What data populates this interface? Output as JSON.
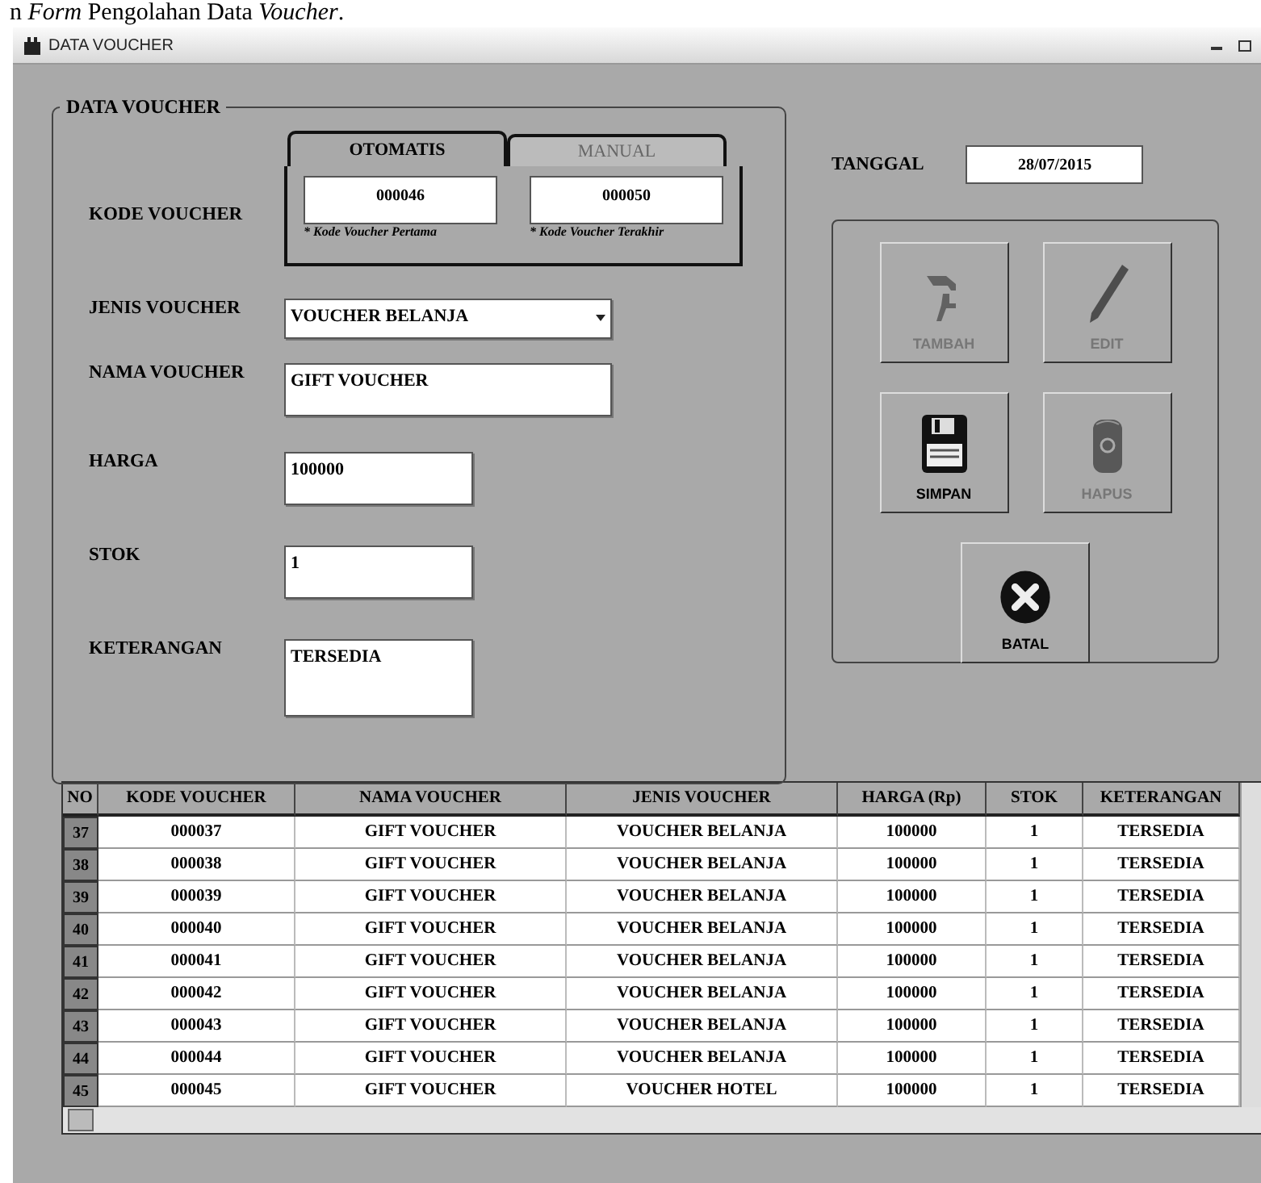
{
  "caption": "n *Form* Pengolahan Data *Voucher*.",
  "window": {
    "title": "DATA VOUCHER"
  },
  "group": {
    "title": "DATA VOUCHER",
    "kode_voucher": {
      "label": "KODE VOUCHER",
      "tabs": [
        {
          "label": "OTOMATIS",
          "selected": true
        },
        {
          "label": "MANUAL",
          "selected": false
        }
      ],
      "fields": [
        {
          "value": "000046",
          "hint": "* Kode Voucher Pertama"
        },
        {
          "value": "000050",
          "hint": "* Kode Voucher Terakhir"
        }
      ]
    },
    "fields": [
      {
        "kind": "dropdown",
        "label": "JENIS VOUCHER",
        "value": "VOUCHER BELANJA"
      },
      {
        "kind": "wide",
        "label": "NAMA VOUCHER",
        "value": "GIFT VOUCHER"
      },
      {
        "kind": "short",
        "label": "HARGA",
        "value": "100000"
      },
      {
        "kind": "short",
        "label": "STOK",
        "value": "1"
      },
      {
        "kind": "memo",
        "label": "KETERANGAN",
        "value": "TERSEDIA"
      }
    ]
  },
  "tanggal": {
    "label": "TANGGAL",
    "value": "28/07/2015"
  },
  "buttons": [
    {
      "kind": "add",
      "label": "TAMBAH",
      "disabled": true
    },
    {
      "kind": "edit",
      "label": "EDIT",
      "disabled": true
    },
    {
      "kind": "save",
      "label": "SIMPAN",
      "disabled": false
    },
    {
      "kind": "delete",
      "label": "HAPUS",
      "disabled": true
    },
    {
      "kind": "cancel",
      "label": "BATAL",
      "disabled": false
    }
  ],
  "table": {
    "columns": [
      "NO",
      "KODE VOUCHER",
      "NAMA VOUCHER",
      "JENIS VOUCHER",
      "HARGA (Rp)",
      "STOK",
      "KETERANGAN"
    ],
    "rows": [
      [
        "37",
        "000037",
        "GIFT VOUCHER",
        "VOUCHER BELANJA",
        "100000",
        "1",
        "TERSEDIA"
      ],
      [
        "38",
        "000038",
        "GIFT VOUCHER",
        "VOUCHER BELANJA",
        "100000",
        "1",
        "TERSEDIA"
      ],
      [
        "39",
        "000039",
        "GIFT VOUCHER",
        "VOUCHER BELANJA",
        "100000",
        "1",
        "TERSEDIA"
      ],
      [
        "40",
        "000040",
        "GIFT VOUCHER",
        "VOUCHER BELANJA",
        "100000",
        "1",
        "TERSEDIA"
      ],
      [
        "41",
        "000041",
        "GIFT VOUCHER",
        "VOUCHER BELANJA",
        "100000",
        "1",
        "TERSEDIA"
      ],
      [
        "42",
        "000042",
        "GIFT VOUCHER",
        "VOUCHER BELANJA",
        "100000",
        "1",
        "TERSEDIA"
      ],
      [
        "43",
        "000043",
        "GIFT VOUCHER",
        "VOUCHER BELANJA",
        "100000",
        "1",
        "TERSEDIA"
      ],
      [
        "44",
        "000044",
        "GIFT VOUCHER",
        "VOUCHER BELANJA",
        "100000",
        "1",
        "TERSEDIA"
      ],
      [
        "45",
        "000045",
        "GIFT VOUCHER",
        "VOUCHER HOTEL",
        "100000",
        "1",
        "TERSEDIA"
      ]
    ]
  }
}
